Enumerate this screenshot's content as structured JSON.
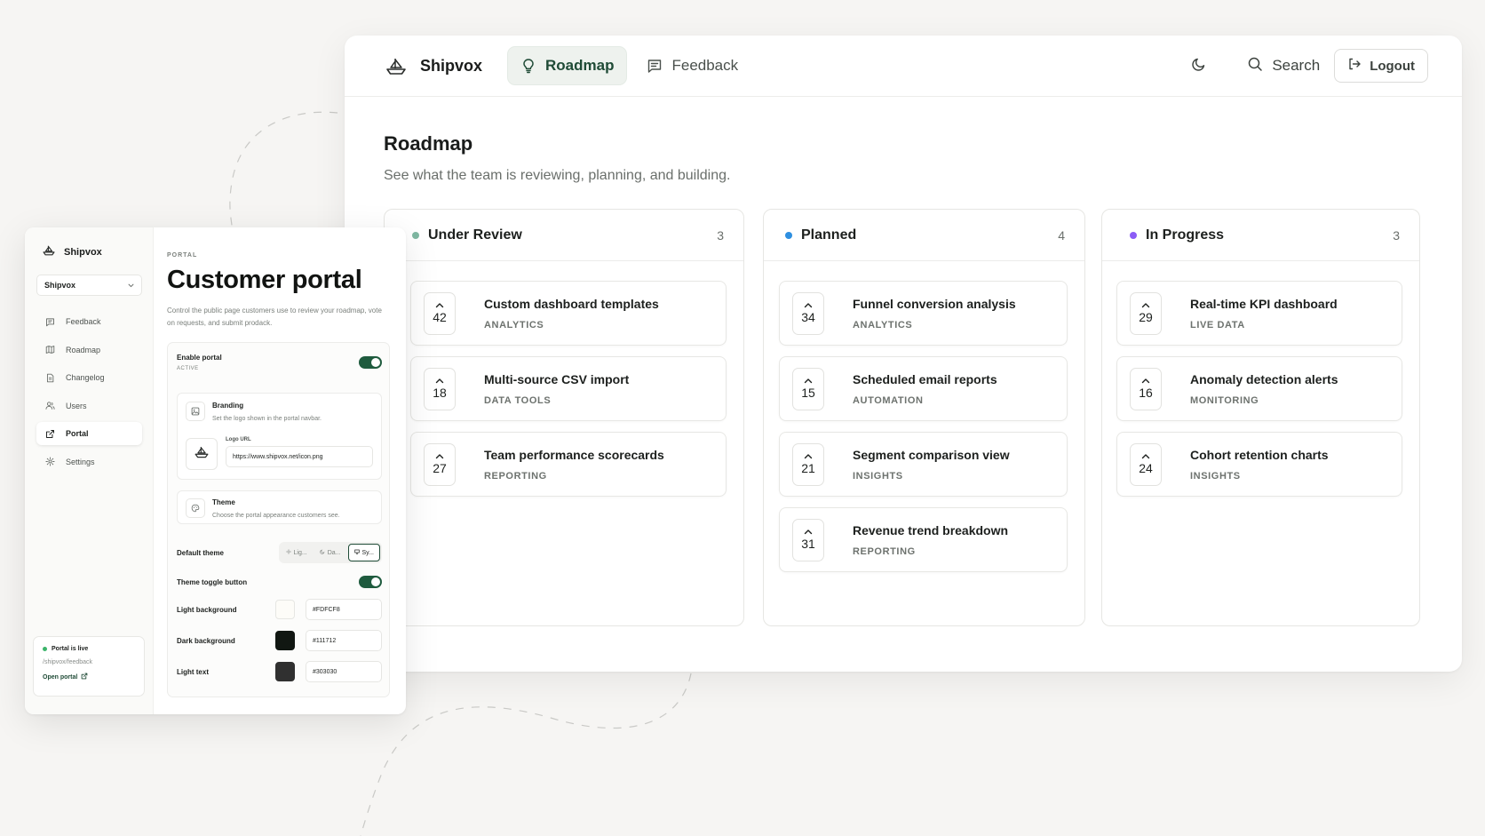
{
  "app": {
    "brand": "Shipvox",
    "nav_tabs": [
      {
        "label": "Roadmap",
        "active": true,
        "icon": "lightbulb-icon"
      },
      {
        "label": "Feedback",
        "active": false,
        "icon": "message-square-icon"
      }
    ],
    "search_label": "Search",
    "logout_label": "Logout"
  },
  "roadmap": {
    "title": "Roadmap",
    "subtitle": "See what the team is reviewing, planning, and building.",
    "columns": [
      {
        "title": "Under Review",
        "count": "3",
        "dot_color": "#7fb8a2",
        "cards": [
          {
            "votes": "42",
            "title": "Custom dashboard templates",
            "tag": "ANALYTICS"
          },
          {
            "votes": "18",
            "title": "Multi-source CSV import",
            "tag": "DATA TOOLS"
          },
          {
            "votes": "27",
            "title": "Team performance scorecards",
            "tag": "REPORTING"
          }
        ]
      },
      {
        "title": "Planned",
        "count": "4",
        "dot_color": "#2e8fe0",
        "cards": [
          {
            "votes": "34",
            "title": "Funnel conversion analysis",
            "tag": "ANALYTICS"
          },
          {
            "votes": "15",
            "title": "Scheduled email reports",
            "tag": "AUTOMATION"
          },
          {
            "votes": "21",
            "title": "Segment comparison view",
            "tag": "INSIGHTS"
          },
          {
            "votes": "31",
            "title": "Revenue trend breakdown",
            "tag": "REPORTING"
          }
        ]
      },
      {
        "title": "In Progress",
        "count": "3",
        "dot_color": "#8b5cf6",
        "cards": [
          {
            "votes": "29",
            "title": "Real-time KPI dashboard",
            "tag": "LIVE DATA"
          },
          {
            "votes": "16",
            "title": "Anomaly detection alerts",
            "tag": "MONITORING"
          },
          {
            "votes": "24",
            "title": "Cohort retention charts",
            "tag": "INSIGHTS"
          }
        ]
      }
    ]
  },
  "admin": {
    "brand": "Shipvox",
    "workspace_select": "Shipvox",
    "sidebar_items": [
      {
        "label": "Feedback",
        "icon": "message-square-icon",
        "active": false
      },
      {
        "label": "Roadmap",
        "icon": "map-icon",
        "active": false
      },
      {
        "label": "Changelog",
        "icon": "file-text-icon",
        "active": false
      },
      {
        "label": "Users",
        "icon": "users-icon",
        "active": false
      },
      {
        "label": "Portal",
        "icon": "external-link-icon",
        "active": true
      },
      {
        "label": "Settings",
        "icon": "gear-icon",
        "active": false
      }
    ],
    "footer": {
      "status": "Portal is live",
      "path": "/shipvox/feedback",
      "open_label": "Open portal"
    },
    "portal": {
      "eyebrow": "PORTAL",
      "title": "Customer portal",
      "description": "Control the public page customers use to review your roadmap, vote on requests, and submit prodack.",
      "enable_label": "Enable portal",
      "enable_status": "ACTIVE",
      "branding_title": "Branding",
      "branding_desc": "Set the logo shown in the portal navbar.",
      "logo_url_label": "Logo URL",
      "logo_url_value": "https://www.shipvox.net/icon.png",
      "theme_title": "Theme",
      "theme_desc": "Choose the portal appearance customers see.",
      "default_theme_label": "Default theme",
      "theme_options": [
        "Lig...",
        "Da...",
        "Sy..."
      ],
      "theme_toggle_label": "Theme toggle button",
      "light_bg_label": "Light background",
      "light_bg_value": "#FDFCF8",
      "dark_bg_label": "Dark background",
      "dark_bg_value": "#111712",
      "light_text_label": "Light text",
      "light_text_value": "#303030"
    }
  },
  "colors": {
    "accent": "#1f5b3e",
    "active_tab_bg": "#eef2ee",
    "live_dot": "#3bb46a",
    "dark_bg_swatch": "#111712",
    "light_text_swatch": "#303030"
  }
}
